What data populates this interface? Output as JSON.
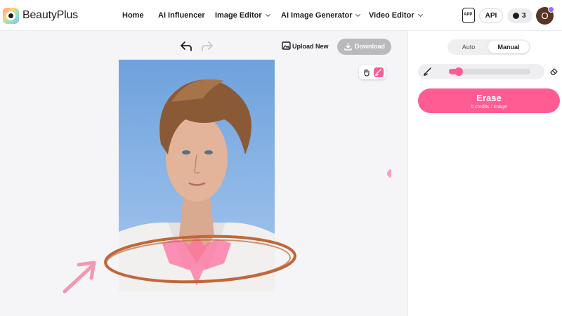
{
  "app": {
    "name": "BeautyPlus"
  },
  "nav": [
    {
      "label": "Home"
    },
    {
      "label": "AI Influencer"
    },
    {
      "label": "Image Editor"
    },
    {
      "label": "AI Image Generator"
    },
    {
      "label": "Video Editor"
    }
  ],
  "header": {
    "app_badge": "APP",
    "api_label": "API",
    "credits": "3",
    "avatar_initial": "O"
  },
  "canvas": {
    "upload_label": "Upload New",
    "download_label": "Download"
  },
  "panel": {
    "mode_auto": "Auto",
    "mode_manual": "Manual",
    "brush_size": 0.08,
    "erase_label": "Erase",
    "erase_cost": "5 credits / image"
  },
  "colors": {
    "accent": "#ff5c93",
    "annotation": "#c0673a",
    "arrow": "#f497b3"
  },
  "icons": [
    "undo-icon",
    "redo-icon",
    "upload-image-icon",
    "download-icon",
    "hand-icon",
    "brush-icon",
    "eraser-icon",
    "app-icon",
    "credit-icon"
  ]
}
